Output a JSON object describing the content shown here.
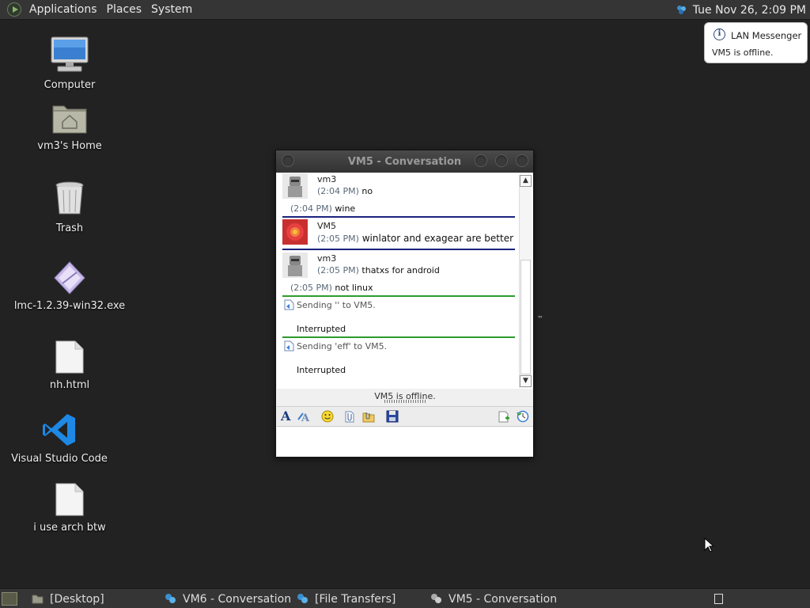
{
  "top_panel": {
    "menus": [
      "Applications",
      "Places",
      "System"
    ],
    "clock": "Tue Nov 26,  2:09 PM"
  },
  "notification": {
    "title": "LAN Messenger",
    "body": "VM5 is offline."
  },
  "desktop_icons": [
    {
      "label": "Computer",
      "icon": "computer-icon"
    },
    {
      "label": "vm3's Home",
      "icon": "home-folder-icon"
    },
    {
      "label": "Trash",
      "icon": "trash-icon"
    },
    {
      "label": "lmc-1.2.39-win32.exe",
      "icon": "exe-file-icon"
    },
    {
      "label": "nh.html",
      "icon": "html-file-icon"
    },
    {
      "label": "Visual Studio Code",
      "icon": "vscode-icon"
    },
    {
      "label": "i use arch btw",
      "icon": "text-file-icon"
    }
  ],
  "window": {
    "title": "VM5 - Conversation",
    "messages": [
      {
        "name": "vm3",
        "lines": [
          {
            "time": "(2:04 PM)",
            "text": "no"
          },
          {
            "time": "(2:04 PM)",
            "text": "wine"
          }
        ]
      },
      {
        "name": "VM5",
        "lines": [
          {
            "time": "(2:05 PM)",
            "text": "winlator and exagear are better"
          }
        ]
      },
      {
        "name": "vm3",
        "lines": [
          {
            "time": "(2:05 PM)",
            "text": "thatxs for android"
          },
          {
            "time": "(2:05 PM)",
            "text": "not linux"
          }
        ]
      }
    ],
    "transfers": [
      {
        "text": "Sending '' to VM5.",
        "status": "Interrupted"
      },
      {
        "text": "Sending 'eff' to VM5.",
        "status": "Interrupted"
      }
    ],
    "status": "VM5 is offline.",
    "colors": {
      "separator_blue": "#1a237e",
      "separator_green": "#2e9b2e"
    }
  },
  "taskbar": {
    "items": [
      "[Desktop]",
      "VM6 - Conversation",
      "[File Transfers]",
      "VM5 - Conversation"
    ]
  },
  "colors": {
    "desktop_bg": "#222222",
    "panel_bg": "#353535"
  }
}
